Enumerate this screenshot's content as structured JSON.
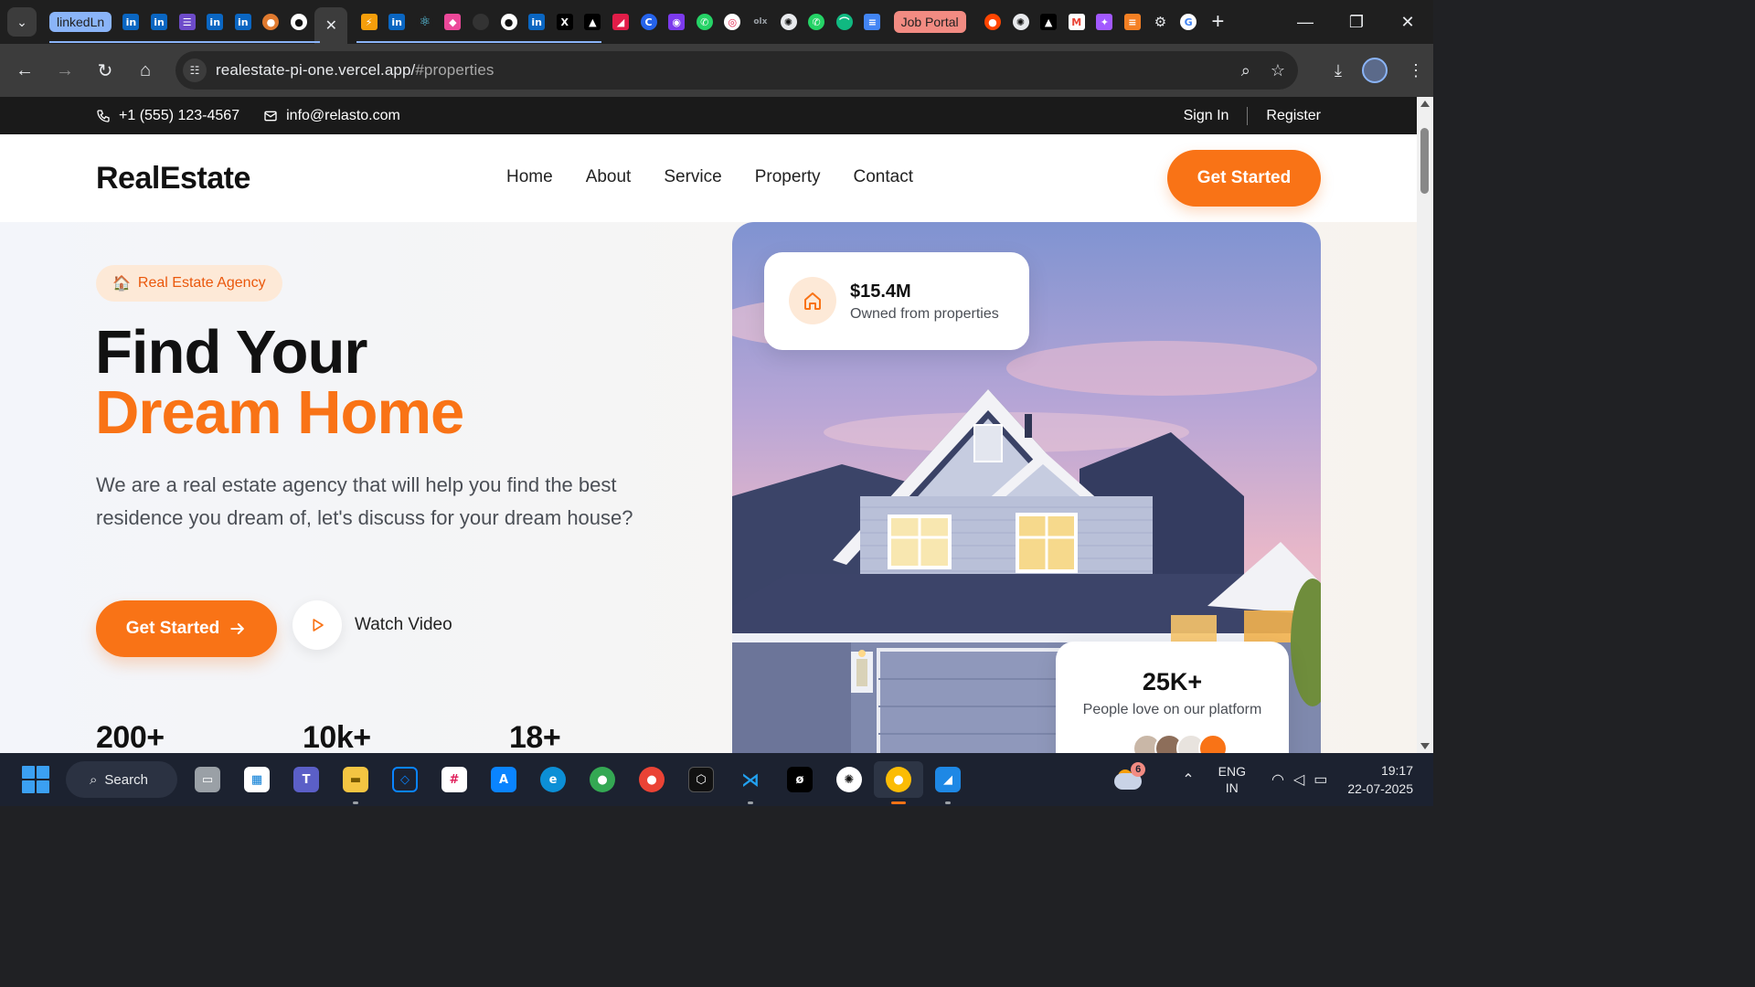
{
  "browser": {
    "tab_group_label": "linkedLn",
    "tab_group2_label": "Job Portal",
    "url_host": "realestate-pi-one.vercel.app/",
    "url_path": "#properties",
    "tab_favicons": [
      "linkedin-icon",
      "linkedin-icon",
      "list-icon",
      "linkedin-icon",
      "linkedin-icon",
      "avatar-icon",
      "github-icon"
    ],
    "tab_favicons_2": [
      "bolt-icon",
      "linkedin-icon",
      "react-icon",
      "flame-icon",
      "blank-icon",
      "github-icon",
      "linkedin-icon",
      "x-icon",
      "triangle-icon",
      "fish-icon",
      "c-icon",
      "tool-icon",
      "whatsapp-icon",
      "target-icon",
      "olx-icon",
      "chatgpt-icon",
      "whatsapp-icon",
      "dome-icon",
      "docs-icon"
    ],
    "tab_favicons_3": [
      "reddit-icon",
      "chatgpt-icon",
      "triangle-icon",
      "gmail-icon",
      "figma-icon",
      "stackoverflow-icon",
      "gear-icon",
      "google-icon"
    ]
  },
  "site": {
    "topbar": {
      "phone": "+1 (555) 123-4567",
      "email": "info@relasto.com",
      "sign_in": "Sign In",
      "register": "Register"
    },
    "logo": "RealEstate",
    "menu": [
      "Home",
      "About",
      "Service",
      "Property",
      "Contact"
    ],
    "cta_top": "Get Started",
    "hero": {
      "badge": "Real Estate Agency",
      "badge_icon": "🏠",
      "title_line1": "Find Your",
      "title_line2": "Dream Home",
      "lead": "We are a real estate agency that will help you find the best residence you dream of, let's discuss for your dream house?",
      "primary_btn": "Get Started",
      "secondary_btn": "Watch Video",
      "stats": [
        "200+",
        "10k+",
        "18+"
      ]
    },
    "card_value": {
      "amount": "$15.4M",
      "label": "Owned from properties"
    },
    "card_love": {
      "number": "25K+",
      "label": "People love on our platform"
    }
  },
  "colors": {
    "accent": "#f97316",
    "badge_bg": "#fde9d7",
    "dark": "#111111"
  },
  "taskbar": {
    "search_label": "Search",
    "weather_count": "6",
    "lang_line1": "ENG",
    "lang_line2": "IN",
    "time": "19:17",
    "date": "22-07-2025"
  }
}
